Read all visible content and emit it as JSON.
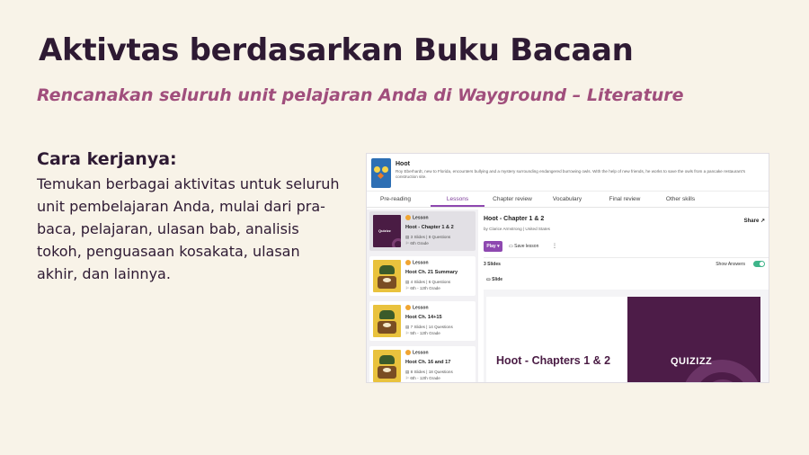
{
  "slide": {
    "title": "Aktivtas berdasarkan Buku Bacaan",
    "subtitle": "Rencanakan seluruh unit pelajaran Anda di Wayground – Literature",
    "how_title": "Cara kerjanya:",
    "how_body": "Temukan berbagai aktivitas untuk seluruh unit pembelajaran Anda, mulai dari pra-baca, pelajaran, ulasan bab, analisis tokoh, penguasaan kosakata, ulasan akhir, dan lainnya."
  },
  "app": {
    "book": {
      "title": "Hoot",
      "description": "Roy Eberhardt, new to Florida, encounters bullying and a mystery surrounding endangered burrowing owls. With the help of new friends, he works to save the owls from a pancake restaurant's construction site."
    },
    "tabs": [
      {
        "label": "Pre-reading",
        "active": false
      },
      {
        "label": "Lessons",
        "active": true
      },
      {
        "label": "Chapter review",
        "active": false
      },
      {
        "label": "Vocabulary",
        "active": false
      },
      {
        "label": "Final review",
        "active": false
      },
      {
        "label": "Other skills",
        "active": false
      }
    ],
    "lessons": [
      {
        "badge": "Lesson",
        "title": "Hoot - Chapter 1 & 2",
        "meta": "3 Slides | 8 Questions",
        "grade": "6th Grade",
        "thumb_label": "Quizizz",
        "selected": true
      },
      {
        "badge": "Lesson",
        "title": "Hoot Ch. 21 Summary",
        "meta": "4 Slides | 6 Questions",
        "grade": "6th - 12th Grade",
        "selected": false
      },
      {
        "badge": "Lesson",
        "title": "Hoot Ch. 14+15",
        "meta": "7 Slides | 14 Questions",
        "grade": "5th - 12th Grade",
        "selected": false
      },
      {
        "badge": "Lesson",
        "title": "Hoot Ch. 16 and 17",
        "meta": "8 Slides | 18 Questions",
        "grade": "6th - 12th Grade",
        "selected": false
      }
    ],
    "detail": {
      "title": "Hoot - Chapter 1 & 2",
      "author": "by Clarice Armstrong | United States",
      "share_label": "Share ↗",
      "play_label": "Play ▾",
      "save_label": "▭ Save lesson",
      "more_label": "⋮",
      "slides_count": "3 Slides",
      "show_answers_label": "Show Answers",
      "show_answers_on": true,
      "slide_label": "▭ Slide",
      "slide_heading": "Hoot - Chapters 1 & 2",
      "slide_brand": "QUIZIZZ"
    }
  },
  "colors": {
    "background": "#f8f3e8",
    "subtitle": "#a04e7c",
    "accent": "#8e48b0",
    "brand_purple": "#4d1c48",
    "toggle_on": "#3fb58a"
  }
}
